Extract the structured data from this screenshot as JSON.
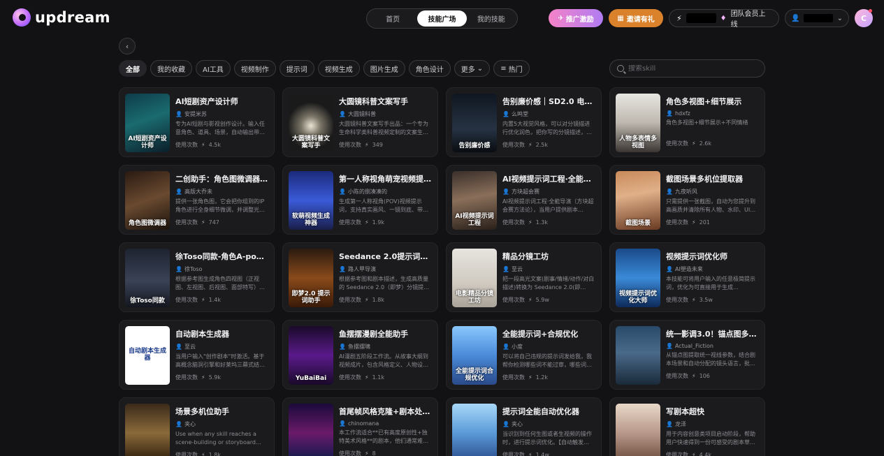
{
  "brand": {
    "name": "updream"
  },
  "nav": {
    "tabs": [
      "首页",
      "技能广场",
      "我的技能"
    ],
    "active": 1
  },
  "header": {
    "promo_label": "推广激励",
    "invite_label": "邀请有礼",
    "team_label": "团队会员上线",
    "avatar_letter": "C"
  },
  "filters": {
    "chips": [
      "全部",
      "我的收藏",
      "AI工具",
      "视频制作",
      "提示词",
      "视频生成",
      "图片生成",
      "角色设计",
      "更多",
      "热门"
    ],
    "active": 0
  },
  "search": {
    "placeholder": "搜索skill"
  },
  "usage_label": "使用次数",
  "cards": [
    {
      "title": "AI短剧资产设计师",
      "author": "安提米苏",
      "desc": "专为AI短剧与影视创作设计。输入任意角色、道具、场景，自动输出带…",
      "count": "4.5k",
      "thumb_text": "AI短剧资产设计师",
      "bg": "linear-gradient(160deg,#0e3b4a,#1a6b6f 45%,#0b1e2a)"
    },
    {
      "title": "大圆镜科普文案写手",
      "author": "大圆镜科普",
      "desc": "大圆镜科普文案写手出品：一个专为生命科学类科普视频定制的文案生成…",
      "count": "349",
      "thumb_text": "大圆镜科普文案写手",
      "bg": "radial-gradient(circle at 50% 55%,#e9e4d4 0,#7a7466 25%,#1a1a1a 60%)"
    },
    {
      "title": "告别廉价感｜SD2.0 电影…",
      "author": "么鸣堂",
      "desc": "内置5大视觉风格，可以对分镜描进行优化润色，把你写的分镜描述，…",
      "count": "2.5k",
      "thumb_text": "告别廉价感",
      "bg": "linear-gradient(180deg,#0f1620,#263243 60%,#0a0d12)"
    },
    {
      "title": "角色多视图+细节展示",
      "author": "hdxfz",
      "desc": "角色多视图+细节展示+不同情绪",
      "count": "2.6k",
      "thumb_text": "人物多表情多视图",
      "bg": "linear-gradient(180deg,#e8e6e2,#bdb7ae 50%,#3a3532)"
    },
    {
      "title": "二创助手：角色图微调器…",
      "author": "高版大乔未",
      "desc": "提供一张角色图，它会把你组到的IP角色进行全身细节微调，并调整光…",
      "count": "747",
      "thumb_text": "角色图微调器",
      "bg": "linear-gradient(160deg,#2a1a12,#6a4a30 50%,#1a120c)"
    },
    {
      "title": "第一人称视角萌宠视频提…",
      "author": "小陈的捌凑凑的",
      "desc": "生成第一人称视角(POV)视频提示词，支持真实画风、一镜到底、带…",
      "count": "1.9k",
      "thumb_text": "软萌视频生成神器",
      "bg": "linear-gradient(180deg,#1b2a7a,#3a5ad8 50%,#1a1f4a)"
    },
    {
      "title": "AI视频提示词工程·全能…",
      "author": "方块超会赛",
      "desc": "AI视频提示词工程·全能导演（方块超会赛方法论），当用户提供剧本…",
      "count": "1.3k",
      "thumb_text": "AI视频提示词工程",
      "bg": "linear-gradient(170deg,#3a2f2a,#8a6f5a 45%,#2a201a)"
    },
    {
      "title": "截图场景多机位提取器",
      "author": "九夜听风",
      "desc": "只需提供一张截图，自动为您提升到高画质并清除所有人物、水印、UI…",
      "count": "201",
      "thumb_text": "截图场景",
      "bg": "linear-gradient(170deg,#c98a5a,#e0b089 40%,#6a3a22)"
    },
    {
      "title": "徐Toso同款-角色A-pos…",
      "author": "徐Toso",
      "desc": "根据参考图生成角色四视图（正视图、左视图、后视图、面部特写）…",
      "count": "1.4k",
      "thumb_text": "徐Toso同款",
      "bg": "linear-gradient(180deg,#1e2330,#3a4256 55%,#14171f)"
    },
    {
      "title": "Seedance 2.0提示词助手",
      "author": "路人甲导演",
      "desc": "根据参考图和剧本描述，生成高质量的 Seedance 2.0（即梦）分镜提…",
      "count": "1.8k",
      "thumb_text": "即梦2.0 提示词助手",
      "bg": "linear-gradient(180deg,#2a1a10,#8a4a1a 50%,#3a1a08)"
    },
    {
      "title": "精品分镜工坊",
      "author": "至云",
      "desc": "把一段高光文案(剧事/情绪/动作/对白描述)转换为 Seedance 2.0(即…",
      "count": "5.9w",
      "thumb_text": "电影精品分镜工坊",
      "bg": "linear-gradient(180deg,#e7e4df,#cfc9c0 60%,#a9a298)"
    },
    {
      "title": "视频提示词优化师",
      "author": "AI塑造未来",
      "desc": "本技能可将用户输入的任意极简提示词，优化为可直接用于生成…",
      "count": "3.5w",
      "thumb_text": "视频提示词优化大师",
      "bg": "linear-gradient(180deg,#1a4a8a,#3a8ad8 50%,#0e2a5a)"
    },
    {
      "title": "自动剧本生成器",
      "author": "至云",
      "desc": "当用户输入\"创作剧本\"时激活。基于高概念脑洞引擎和好莱坞三幕式结…",
      "count": "5.9k",
      "thumb_text": "自动剧本生成器",
      "bg": "#ffffff"
    },
    {
      "title": "鱼摆摆漫剧全能助手",
      "author": "鱼摆摆啸",
      "desc": "AI漫剧五阶段工作流。从故事大纲到视频成片，包含风格定义、人物设…",
      "count": "1.1k",
      "thumb_text": "YuBaiBai",
      "bg": "linear-gradient(180deg,#1a0a2a,#5a1a8a 50%,#1a0a2a)"
    },
    {
      "title": "全能提示词+合规优化",
      "author": "小度",
      "desc": "可以将自己违规的提示词发给我，我帮你检测哪些词不能过审，哪些词…",
      "count": "1.2k",
      "thumb_text": "全能提示词合规优化",
      "bg": "linear-gradient(180deg,#8ac8ff,#4a8ad8 50%,#2a4a8a)"
    },
    {
      "title": "统一影调3.0！锚点图多…",
      "author": "Actual_Fiction",
      "desc": "从锚点图提取统一视线参数，结合剧本场景和自动分配的镜头语言，批…",
      "count": "106",
      "thumb_text": "",
      "bg": "linear-gradient(180deg,#2a4a6a,#4a6a8a 45%,#1a2a3a)"
    },
    {
      "title": "场景多机位助手",
      "author": "夹心",
      "desc": "Use when any skill reaches a scene-building or storyboard…",
      "count": "1.8k",
      "thumb_text": "",
      "bg": "linear-gradient(180deg,#3a2a1a,#8a6a3a 50%,#2a1a0a)"
    },
    {
      "title": "首尾帧风格克隆+剧本处…",
      "author": "chinomana",
      "desc": "本工作流适合**已有高度原创性+独特美术风格**的剧本，他们通常难…",
      "count": "8",
      "thumb_text": "",
      "bg": "linear-gradient(180deg,#1a0a3a,#6a1a6a 50%,#0a1a4a)"
    },
    {
      "title": "提示词全能自动优化器",
      "author": "夹心",
      "desc": "当识别到任何生图或者生视频的操作时，进行提示词优化。【自动触发…",
      "count": "1.4w",
      "thumb_text": "",
      "bg": "linear-gradient(180deg,#a8d8f8,#5a9ad8 50%,#2a4a8a)"
    },
    {
      "title": "写剧本超快",
      "author": "龙泽",
      "desc": "用于内容创意类项目启动阶段，帮助用户快速得到一份可感受的剧本草…",
      "count": "4.4k",
      "thumb_text": "",
      "bg": "linear-gradient(180deg,#e8d8c8,#b8988a 50%,#6a4a3a)"
    }
  ]
}
